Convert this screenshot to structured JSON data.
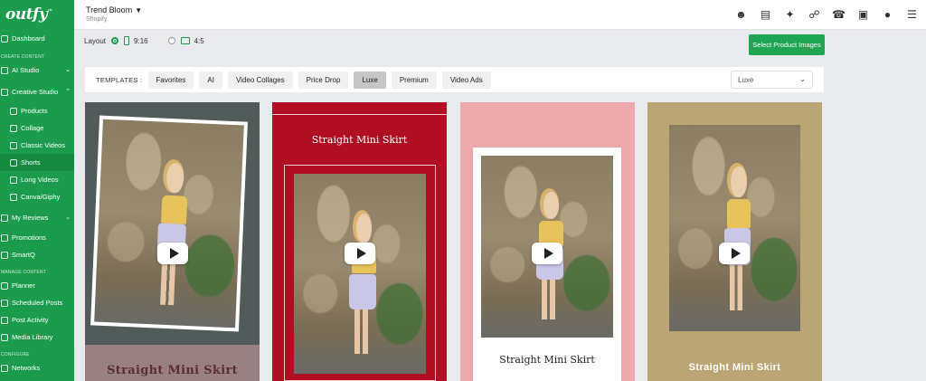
{
  "brand": {
    "logo_text": "outfy",
    "logo_mark": "™",
    "accent": "#1a9c4c"
  },
  "sidebar": {
    "dashboard": "Dashboard",
    "section_create": "CREATE CONTENT",
    "ai_studio": "AI Studio",
    "creative_studio": "Creative Studio",
    "sub": [
      "Products",
      "Collage",
      "Classic Videos",
      "Shorts",
      "Long Videos",
      "Canva/Giphy"
    ],
    "my_reviews": "My Reviews",
    "promotions": "Promotions",
    "smartq": "SmartQ",
    "section_manage": "MANAGE CONTENT",
    "planner": "Planner",
    "scheduled_posts": "Scheduled Posts",
    "post_activity": "Post Activity",
    "media_library": "Media Library",
    "section_configure": "CONFIGURE",
    "networks": "Networks"
  },
  "topbar": {
    "store_name": "Trend Bloom",
    "store_platform": "Shopify",
    "icons": [
      "user-icon",
      "billing-icon",
      "magic-icon",
      "handshake-icon",
      "support-icon",
      "gift-icon",
      "notifications-icon",
      "menu-icon"
    ]
  },
  "layout": {
    "label": "Layout",
    "options": [
      "9:16",
      "4:5"
    ],
    "selected": "9:16"
  },
  "select_button": "Select Product Images",
  "templates": {
    "label": "TEMPLATES :",
    "tabs": [
      "Favorites",
      "AI",
      "Video Collages",
      "Price Drop",
      "Luxe",
      "Premium",
      "Video Ads"
    ],
    "active": "Luxe",
    "dropdown_value": "Luxe"
  },
  "cards": [
    {
      "title": "Straight Mini Skirt",
      "bg": "#505b5a"
    },
    {
      "title": "Straight Mini Skirt",
      "bg": "#b00e23"
    },
    {
      "title": "Straight Mini Skirt",
      "bg": "#eea9ad"
    },
    {
      "title": "Straight Mini Skirt",
      "bg": "#b9a674"
    }
  ]
}
